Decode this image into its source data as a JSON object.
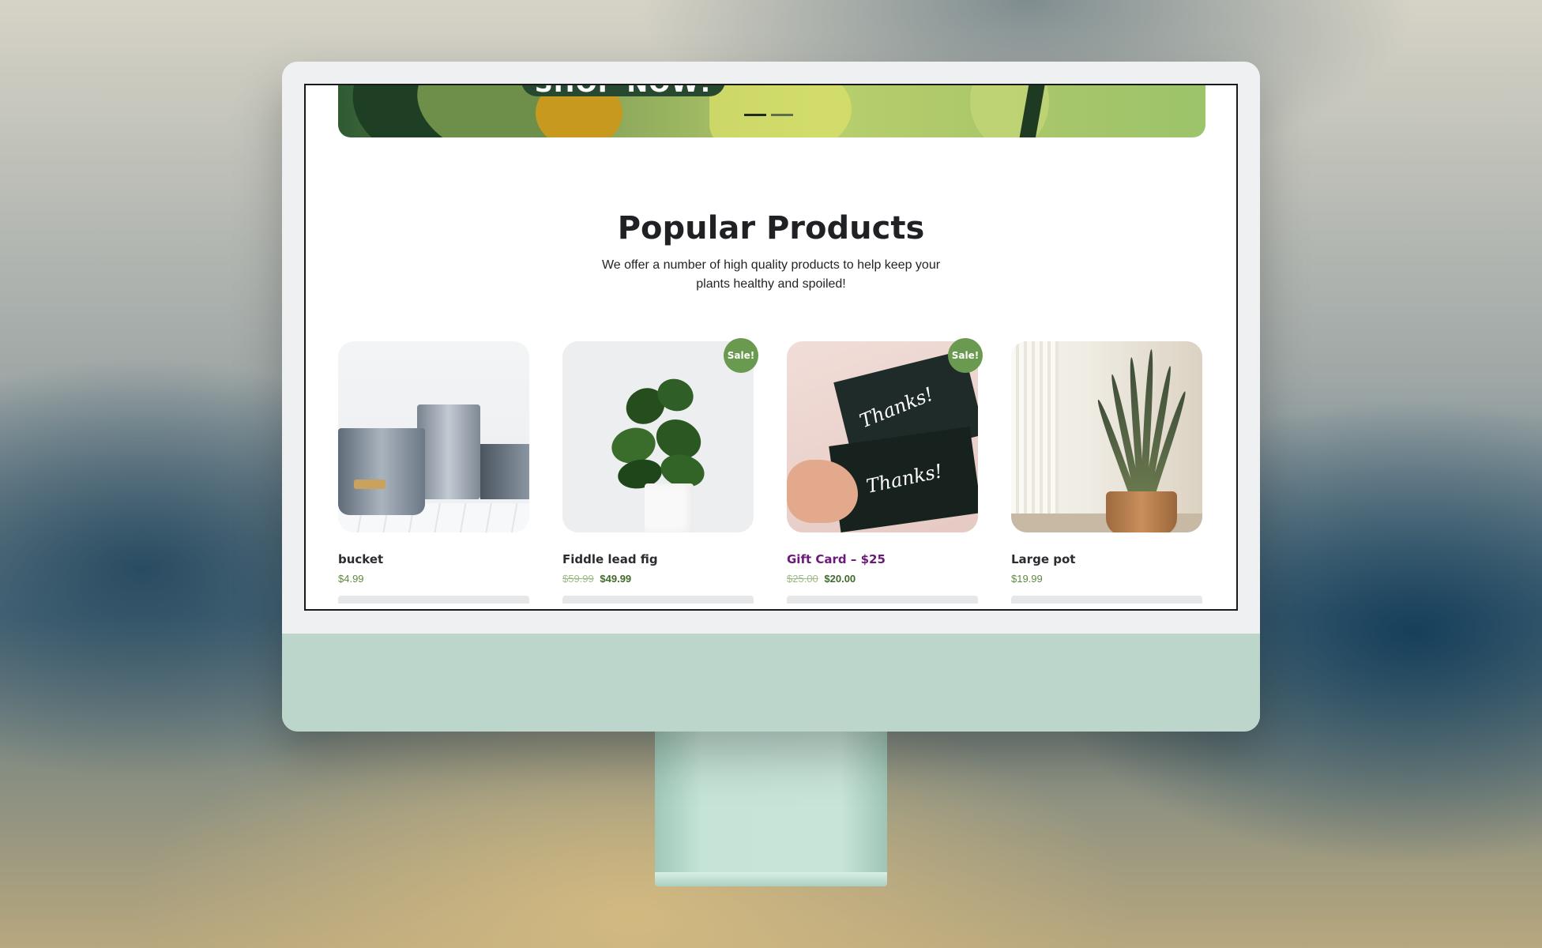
{
  "hero": {
    "cta_label": "SHOP NOW!",
    "slides": [
      {
        "active": true
      },
      {
        "active": false
      }
    ]
  },
  "section": {
    "title": "Popular Products",
    "subtitle": "We offer a number of high quality products to help keep your plants healthy and spoiled!"
  },
  "products": [
    {
      "name": "bucket",
      "price": "$4.99",
      "sale": false
    },
    {
      "name": "Fiddle lead fig",
      "old_price": "$59.99",
      "price": "$49.99",
      "sale": true,
      "badge": "Sale!"
    },
    {
      "name": "Gift Card – $25",
      "old_price": "$25.00",
      "price": "$20.00",
      "sale": true,
      "badge": "Sale!",
      "card_text": "Thanks!"
    },
    {
      "name": "Large pot",
      "price": "$19.99",
      "sale": false
    }
  ],
  "colors": {
    "accent_green": "#6a9a4f",
    "price_green": "#5f8a3f",
    "link_purple": "#6b1a7a",
    "monitor_body": "#bcd6cb",
    "hero_cta": "#27492f"
  }
}
